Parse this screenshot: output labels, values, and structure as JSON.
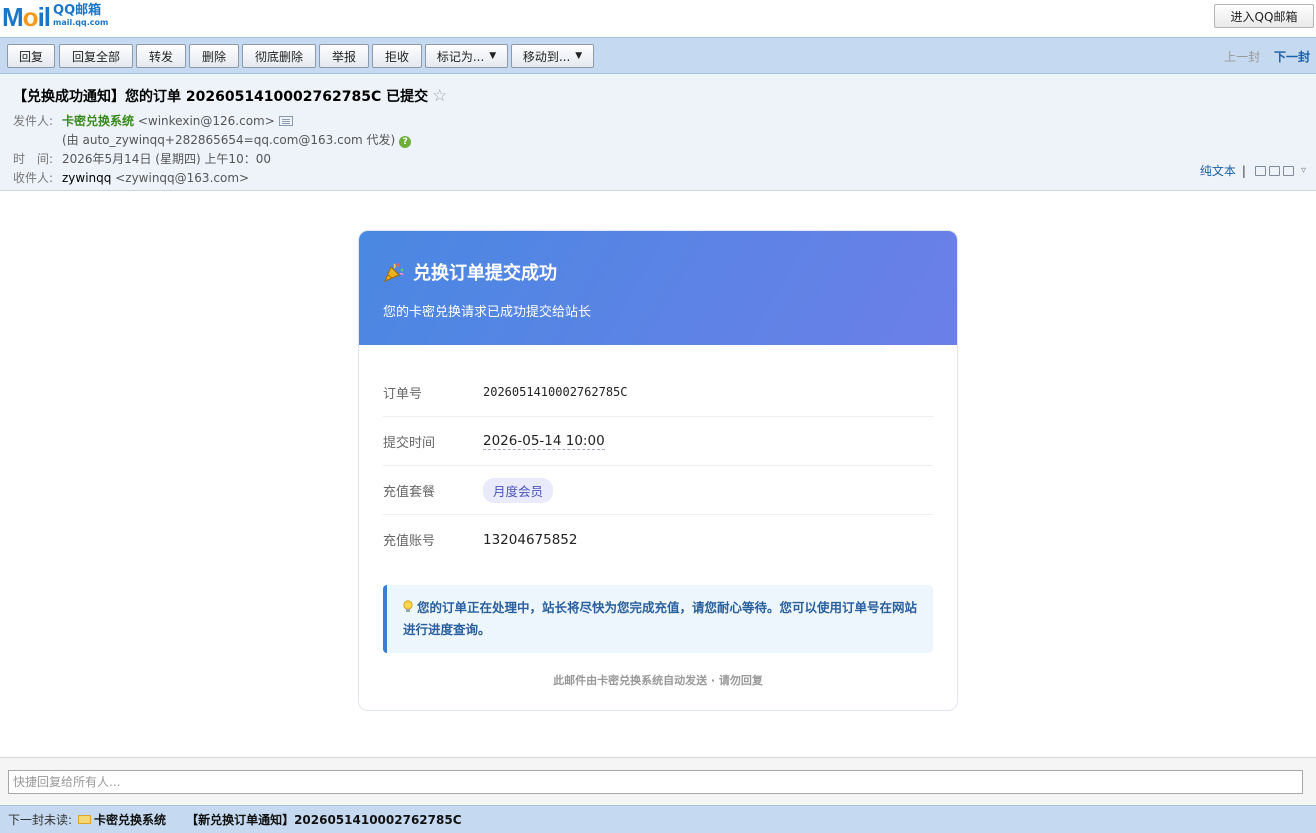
{
  "app": {
    "logo_prefix": "M",
    "logo_o": "o",
    "logo_suffix": "il",
    "logo_cn": "QQ邮箱",
    "logo_domain": "mail.qq.com",
    "enter_button": "进入QQ邮箱"
  },
  "toolbar": {
    "buttons": [
      "回复",
      "回复全部",
      "转发",
      "删除",
      "彻底删除",
      "举报",
      "拒收"
    ],
    "mark_as": "标记为...",
    "move_to": "移动到...",
    "prev": "上一封",
    "next": "下一封"
  },
  "mail": {
    "subject": "【兑换成功通知】您的订单 2026051410002762785C 已提交",
    "star": "☆",
    "sender_label": "发件人:",
    "sender_name": "卡密兑换系统",
    "sender_email": "<winkexin@126.com>",
    "proxy_note": "(由 auto_zywinqq+282865654=qq.com@163.com 代发)",
    "time_label": "时　间:",
    "time_value": "2026年5月14日 (星期四) 上午10：00",
    "recipient_label": "收件人:",
    "recipient_name": "zywinqq",
    "recipient_email": "<zywinqq@163.com>",
    "plain_text": "纯文本",
    "separator": "|"
  },
  "body": {
    "title": "兑换订单提交成功",
    "subtitle": "您的卡密兑换请求已成功提交给站长",
    "rows": [
      {
        "label": "订单号",
        "value": "2026051410002762785C"
      },
      {
        "label": "提交时间",
        "value": "2026-05-14 10:00"
      },
      {
        "label": "充值套餐",
        "value": "月度会员"
      },
      {
        "label": "充值账号",
        "value": "13204675852"
      }
    ],
    "notice": "您的订单正在处理中，站长将尽快为您完成充值，请您耐心等待。您可以使用订单号在网站进行进度查询。",
    "footer": "此邮件由卡密兑换系统自动发送 · 请勿回复"
  },
  "quick_reply": {
    "placeholder": "快捷回复给所有人..."
  },
  "bottom_bar": {
    "label": "下一封未读:",
    "from": "卡密兑换系统",
    "subject": "【新兑换订单通知】2026051410002762785C"
  },
  "colors": {
    "toolbar_bg": "#c5daf0",
    "header_bg": "#eef3fa",
    "banner_start": "#4a88e2",
    "banner_end": "#6b7fe8",
    "sender_green": "#3a8a1e",
    "link_blue": "#1a5fa8"
  }
}
